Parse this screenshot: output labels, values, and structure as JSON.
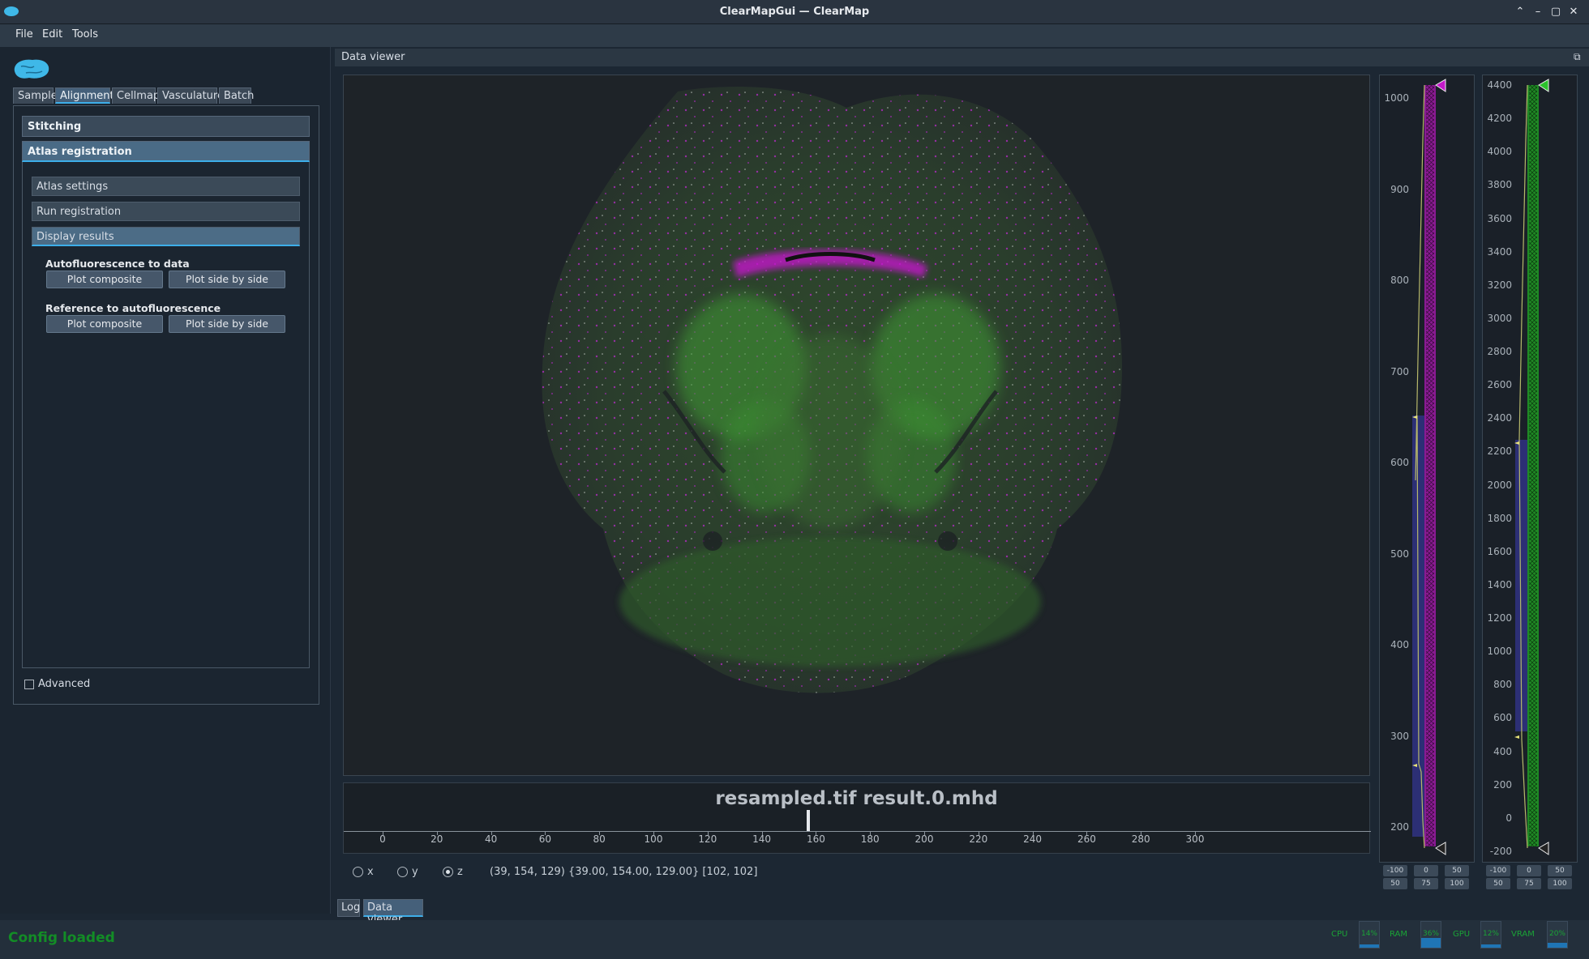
{
  "window": {
    "title": "ClearMapGui — ClearMap"
  },
  "menu": [
    "File",
    "Edit",
    "Tools"
  ],
  "tabs": [
    "Sample",
    "Alignment",
    "Cellmap",
    "Vasculature",
    "Batch"
  ],
  "sections": {
    "stitching": "Stitching",
    "atlas_registration": "Atlas registration",
    "atlas_settings": "Atlas settings",
    "run_registration": "Run registration",
    "display_results": "Display results"
  },
  "groups": [
    {
      "label": "Autofluorescence to data",
      "btn1": "Plot composite",
      "btn2": "Plot side by side"
    },
    {
      "label": "Reference to autofluorescence",
      "btn1": "Plot composite",
      "btn2": "Plot side by side"
    }
  ],
  "advanced_label": "Advanced",
  "dock_title": "Data viewer",
  "timeline": {
    "title": "resampled.tif result.0.mhd",
    "ticks": [
      "0",
      "20",
      "40",
      "60",
      "80",
      "100",
      "120",
      "140",
      "160",
      "180",
      "200",
      "220",
      "240",
      "260",
      "280",
      "300"
    ]
  },
  "histogram1": {
    "labels": [
      "1000",
      "900",
      "800",
      "700",
      "600",
      "500",
      "400",
      "300",
      "200"
    ],
    "buttons": [
      "-100",
      "0",
      "50",
      "50",
      "75",
      "100"
    ]
  },
  "histogram2": {
    "labels": [
      "4400",
      "4200",
      "4000",
      "3800",
      "3600",
      "3400",
      "3200",
      "3000",
      "2800",
      "2600",
      "2400",
      "2200",
      "2000",
      "1800",
      "1600",
      "1400",
      "1200",
      "1000",
      "800",
      "600",
      "400",
      "200",
      "0",
      "-200"
    ],
    "buttons": [
      "-100",
      "0",
      "50",
      "50",
      "75",
      "100"
    ]
  },
  "axes": [
    "x",
    "y",
    "z"
  ],
  "coords": "(39, 154, 129) {39.00, 154.00, 129.00} [102, 102]",
  "bottom_tabs": [
    "Log",
    "Data viewer"
  ],
  "status": {
    "text": "Config loaded",
    "gauges": [
      {
        "label": "CPU",
        "value": "14%"
      },
      {
        "label": "RAM",
        "value": "36%"
      },
      {
        "label": "GPU",
        "value": "12%"
      },
      {
        "label": "VRAM",
        "value": "20%"
      }
    ]
  },
  "colors": {
    "accent": "#3daee9",
    "magenta": "#c318c9",
    "green": "#1f9e25",
    "status_green": "#138d26"
  }
}
